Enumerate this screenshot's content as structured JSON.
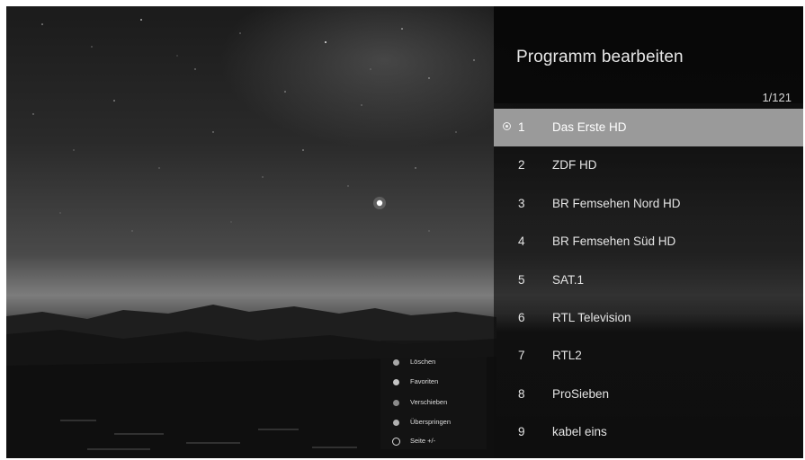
{
  "panel": {
    "title": "Programm bearbeiten",
    "page_counter": "1/121"
  },
  "channels": [
    {
      "number": "1",
      "name": "Das Erste HD",
      "selected": true
    },
    {
      "number": "2",
      "name": "ZDF HD"
    },
    {
      "number": "3",
      "name": "BR Femsehen Nord HD"
    },
    {
      "number": "4",
      "name": "BR Femsehen Süd HD"
    },
    {
      "number": "5",
      "name": "SAT.1"
    },
    {
      "number": "6",
      "name": "RTL Television"
    },
    {
      "number": "7",
      "name": "RTL2"
    },
    {
      "number": "8",
      "name": "ProSieben"
    },
    {
      "number": "9",
      "name": "kabel eins"
    }
  ],
  "legend": [
    {
      "label": "Löschen",
      "icon": "delete-key-icon"
    },
    {
      "label": "Favoriten",
      "icon": "favorites-key-icon"
    },
    {
      "label": "Verschieben",
      "icon": "move-key-icon"
    },
    {
      "label": "Überspringen",
      "icon": "skip-key-icon"
    },
    {
      "label": "Seite +/-",
      "icon": "page-up-down-icon"
    }
  ],
  "colors": {
    "selected_row": "#9a9a9a",
    "panel_background": "#0c0c0c",
    "text": "#e4e4e4"
  }
}
